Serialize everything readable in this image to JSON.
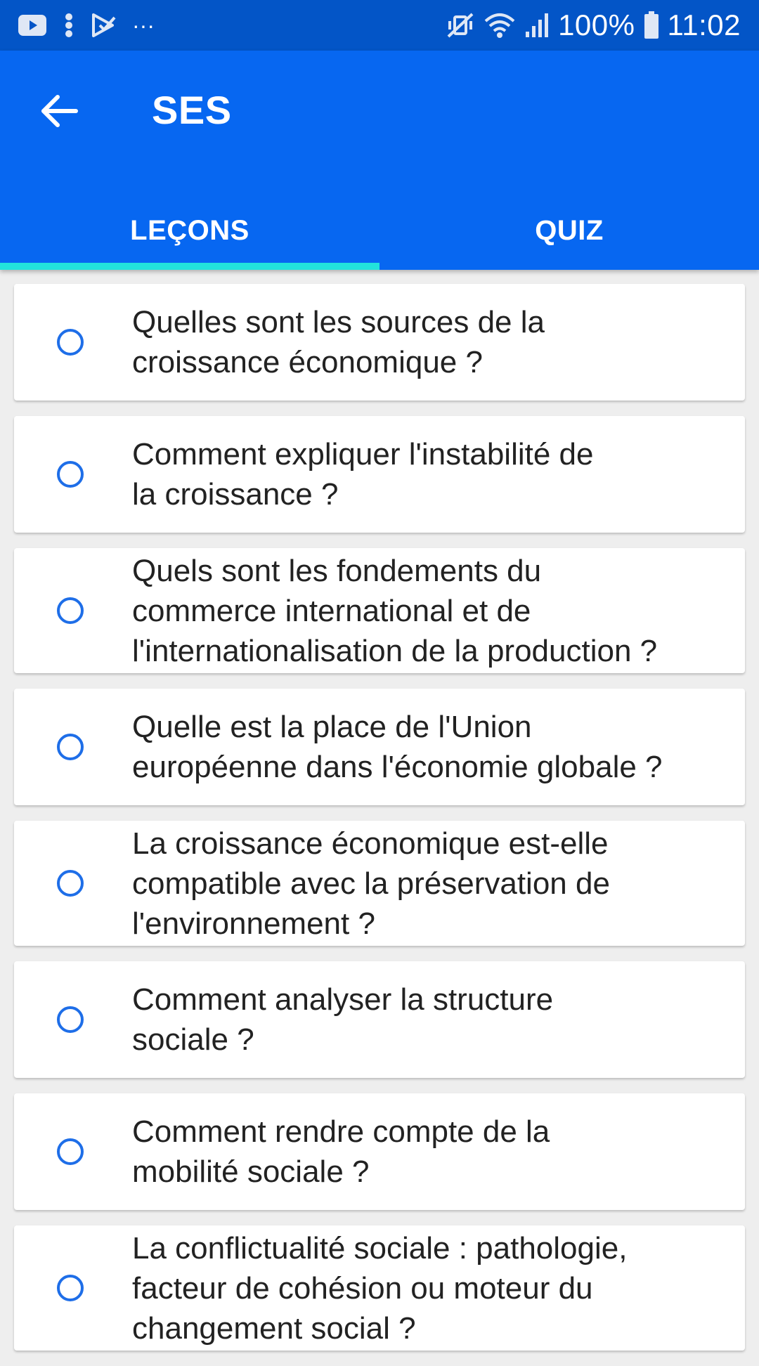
{
  "status_bar": {
    "battery": "100%",
    "time": "11:02",
    "overflow": "···"
  },
  "app_bar": {
    "title": "SES"
  },
  "tabs": [
    {
      "label": "LEÇONS",
      "active": true
    },
    {
      "label": "QUIZ",
      "active": false
    }
  ],
  "lessons": [
    {
      "title": "Quelles sont les sources de la\ncroissance économique ?"
    },
    {
      "title": "Comment expliquer l'instabilité de\nla croissance ?"
    },
    {
      "title": "Quels sont les fondements du\ncommerce international et de\nl'internationalisation de la production ?"
    },
    {
      "title": "Quelle est la place de l'Union\neuropéenne dans l'économie globale ?"
    },
    {
      "title": "La croissance économique est-elle\ncompatible avec la préservation de\nl'environnement ?"
    },
    {
      "title": "Comment analyser la structure\nsociale ?"
    },
    {
      "title": "Comment rendre compte de la\nmobilité sociale ?"
    },
    {
      "title": "La conflictualité sociale : pathologie,\nfacteur de cohésion ou moteur du\nchangement social ?"
    }
  ],
  "colors": {
    "status_bar": "#0355c7",
    "app_bar": "#0767f1",
    "tab_indicator": "#22e3dc",
    "radio": "#1e6ee8"
  }
}
